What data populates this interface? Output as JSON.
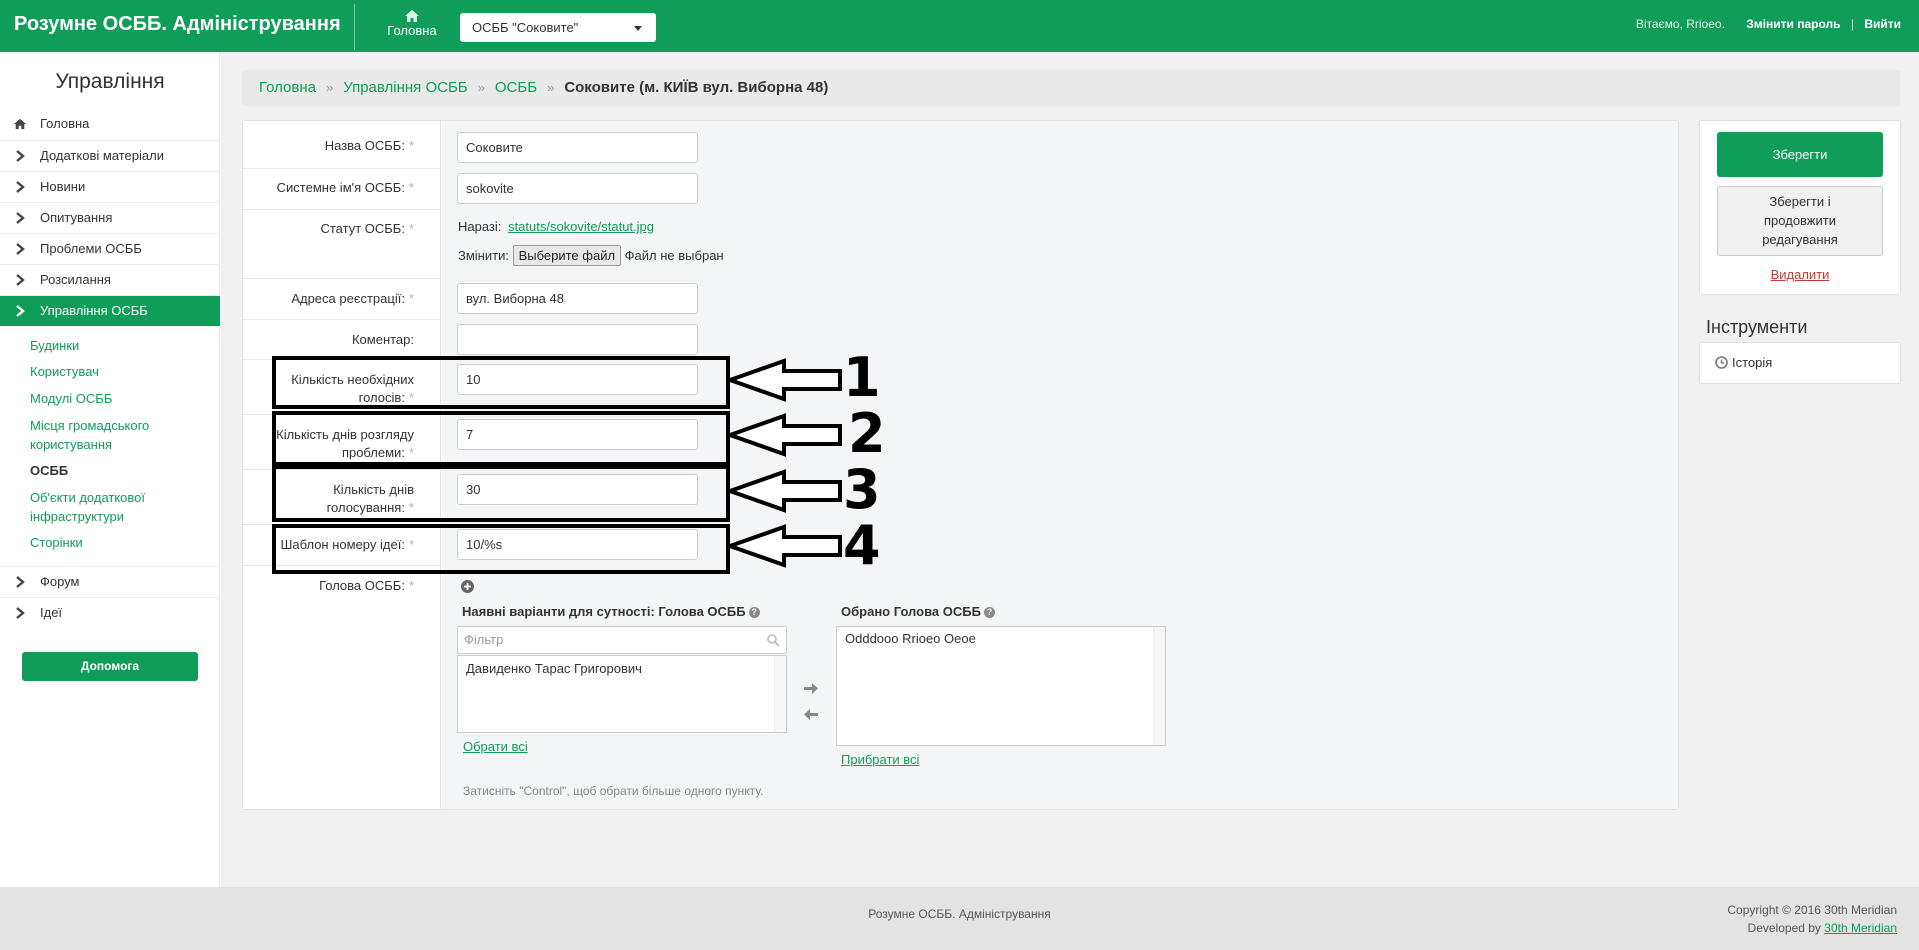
{
  "header": {
    "brand": "Розумне ОСББ. Адміністрування",
    "home_label": "Головна",
    "osbb_select": "ОСББ \"Соковите\"",
    "greeting": "Вітаємо, Rrioeo.",
    "change_password": "Змінити пароль",
    "separator": "|",
    "logout": "Вийти"
  },
  "sidebar": {
    "title": "Управління",
    "items": [
      {
        "label": "Головна",
        "icon": "home-icon"
      },
      {
        "label": "Додаткові матеріали",
        "icon": "chevron-right-icon"
      },
      {
        "label": "Новини",
        "icon": "chevron-right-icon"
      },
      {
        "label": "Опитування",
        "icon": "chevron-right-icon"
      },
      {
        "label": "Проблеми ОСББ",
        "icon": "chevron-right-icon"
      },
      {
        "label": "Розсилання",
        "icon": "chevron-right-icon"
      },
      {
        "label": "Управління ОСББ",
        "icon": "chevron-right-icon"
      }
    ],
    "subitems": [
      {
        "label": "Будинки"
      },
      {
        "label": "Користувач"
      },
      {
        "label": "Модулі ОСББ"
      },
      {
        "label": "Місця громадського користування"
      },
      {
        "label": "ОСББ"
      },
      {
        "label": "Об'єкти додаткової інфраструктури"
      },
      {
        "label": "Сторінки"
      }
    ],
    "bottom_items": [
      {
        "label": "Форум",
        "icon": "chevron-right-icon"
      },
      {
        "label": "Ідеї",
        "icon": "chevron-right-icon"
      }
    ],
    "help_button": "Допомога"
  },
  "breadcrumb": {
    "items": [
      "Головна",
      "Управління ОСББ",
      "ОСББ"
    ],
    "separator": "»",
    "current": "Соковите (м. КИЇВ вул. Виборна 48)"
  },
  "form": {
    "required_mark": "*",
    "name_label": "Назва ОСББ:",
    "name_value": "Соковите",
    "system_name_label": "Системне ім'я ОСББ:",
    "system_name_value": "sokovite",
    "statute_label": "Статут ОСББ:",
    "statute_current_prefix": "Наразі:",
    "statute_current_link": "statuts/sokovite/statut.jpg",
    "statute_change_prefix": "Змінити:",
    "file_button": "Выберите файл",
    "file_status": "Файл не выбран",
    "address_label": "Адреса реєстрації:",
    "address_value": "вул. Виборна 48",
    "comment_label": "Коментар:",
    "comment_value": "",
    "votes_label_1": "Кількість необхідних",
    "votes_label_2": "голосів:",
    "votes_value": "10",
    "review_days_label_1": "Кількість днів розгляду",
    "review_days_label_2": "проблеми:",
    "review_days_value": "7",
    "voting_days_label_1": "Кількість днів",
    "voting_days_label_2": "голосування:",
    "voting_days_value": "30",
    "idea_template_label": "Шаблон номеру ідеї:",
    "idea_template_value": "10/%s",
    "head_label": "Голова ОСББ:",
    "available_title": "Наявні варіанти для сутності: Голова ОСББ",
    "filter_placeholder": "Фільтр",
    "available_options": [
      "Давиденко Тарас Григорович"
    ],
    "select_all": "Обрати всі",
    "chosen_title": "Обрано Голова ОСББ",
    "chosen_options": [
      "Odddooo Rrioeo Oeoe"
    ],
    "remove_all": "Прибрати всі",
    "hint": "Затисніть \"Control\", щоб обрати більше одного пункту."
  },
  "annotations": [
    "1",
    "2",
    "3",
    "4"
  ],
  "actions": {
    "save": "Зберегти",
    "save_continue_1": "Зберегти і",
    "save_continue_2": "продовжити",
    "save_continue_3": "редагування",
    "delete": "Видалити"
  },
  "tools": {
    "title": "Інструменти",
    "history": "Історія"
  },
  "footer": {
    "center": "Розумне ОСББ. Адміністрування",
    "copyright": "Copyright © 2016 30th Meridian",
    "developed_prefix": "Developed by",
    "developed_link": "30th Meridian"
  },
  "colors": {
    "brand_green": "#0f9d58",
    "annotation_black": "#000000",
    "delete_red": "#c0392b"
  }
}
